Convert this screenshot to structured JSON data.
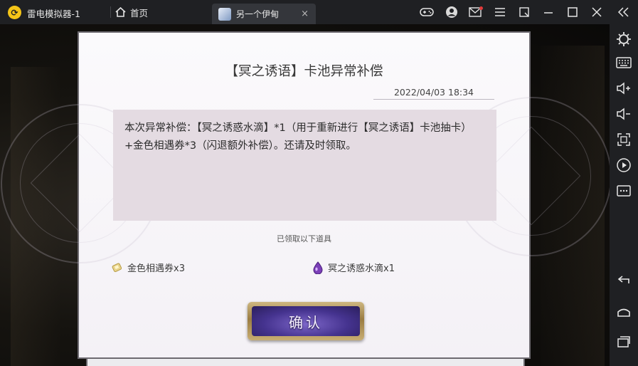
{
  "titlebar": {
    "app_title": "雷电模拟器-1",
    "home_label": "首页",
    "tab_label": "另一个伊甸",
    "tab_close": "×",
    "icons": [
      "gamepad-icon",
      "user-icon",
      "mail-icon",
      "menu-icon",
      "restore-icon",
      "minimize-icon",
      "maximize-icon",
      "close-icon",
      "collapse-icon"
    ],
    "mail_badge_color": "#e23b3b"
  },
  "sidebar": {
    "icons": [
      "settings-icon",
      "keyboard-icon",
      "volume-up-icon",
      "volume-down-icon",
      "fullscreen-icon",
      "record-icon",
      "more-icon",
      "back-icon",
      "home-icon",
      "recent-apps-icon"
    ]
  },
  "dialog": {
    "title": "【冥之诱语】卡池异常补偿",
    "date": "2022/04/03 18:34",
    "message": "本次异常补偿：【冥之诱惑水滴】*1（用于重新进行【冥之诱语】卡池抽卡）+金色相遇券*3（闪退额外补偿）。还请及时领取。",
    "received_label": "已领取以下道具",
    "rewards": [
      {
        "icon": "golden-ticket-icon",
        "label": "金色相遇券x3"
      },
      {
        "icon": "purple-droplet-icon",
        "label": "冥之诱惑水滴x1"
      }
    ],
    "confirm_label": "确认"
  },
  "colors": {
    "titlebar_bg": "#1f2023",
    "dialog_bg": "#f7f5f8",
    "message_bg": "#e4dbe2",
    "confirm_purple": "#45338f",
    "confirm_gold": "#c8ad72"
  }
}
